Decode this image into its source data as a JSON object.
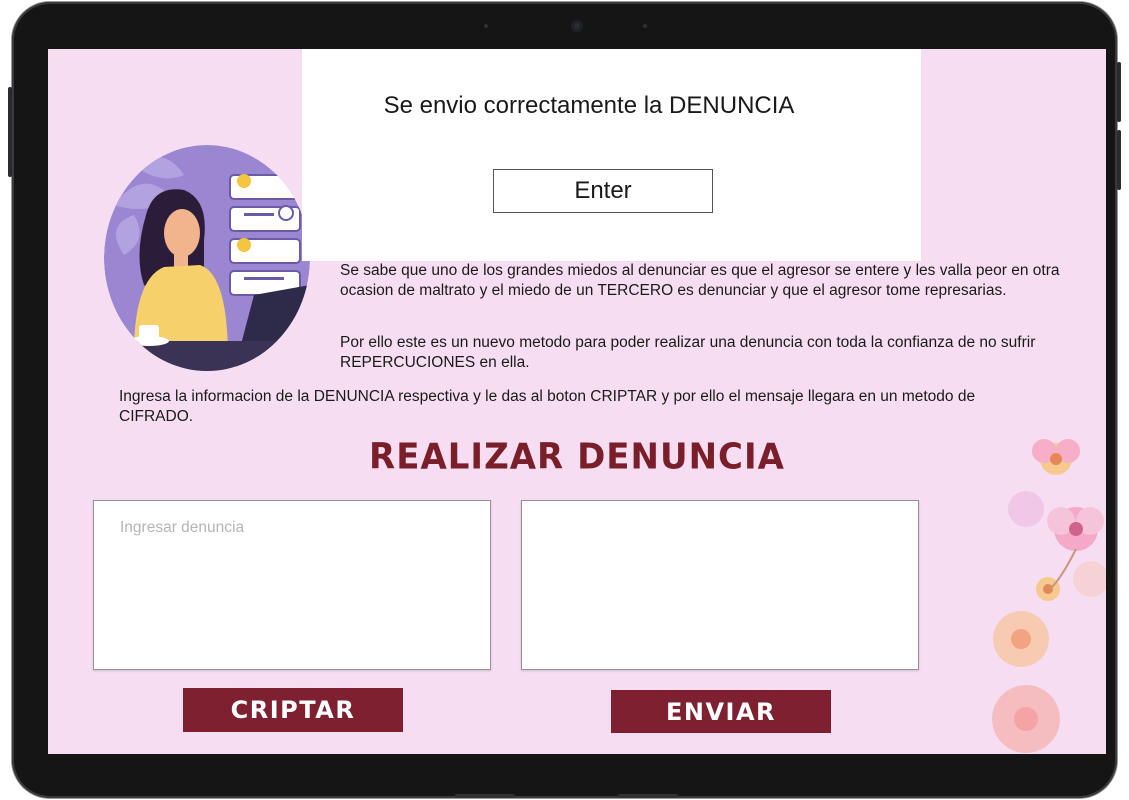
{
  "intro": {
    "paragraph1": "Se sabe que uno de los grandes miedos al denunciar es que el agresor se entere y les valla peor en otra ocasion de maltrato y el miedo de un TERCERO es denunciar y que el agresor tome represarias.",
    "paragraph2": "Por ello este es un nuevo metodo para poder realizar una denuncia con toda la confianza de no sufrir REPERCUCIONES en ella.",
    "instructions": "Ingresa la informacion de la DENUNCIA respectiva y le das al boton CRIPTAR y por ello el mensaje llegara en un metodo de CIFRADO."
  },
  "form": {
    "title": "REALIZAR DENUNCIA",
    "input_placeholder": "Ingresar denuncia",
    "input_value": "",
    "output_value": "",
    "criptar_label": "CRIPTAR",
    "enviar_label": "ENVIAR"
  },
  "modal": {
    "message": "Se envio correctamente la DENUNCIA",
    "button_label": "Enter"
  },
  "colors": {
    "background": "#f6ddf1",
    "accent": "#7e2030",
    "title": "#7a1f2a",
    "illustration_bg": "#9b87d1"
  },
  "icons": {
    "illustration": "woman-on-phone-illustration",
    "decoration": "flowers-decoration"
  }
}
